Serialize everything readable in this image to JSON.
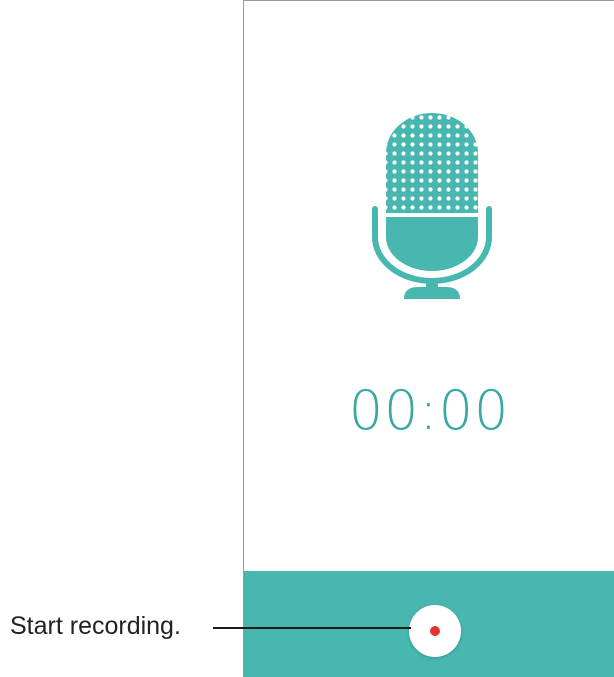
{
  "recorder": {
    "timer": "00:00",
    "accent_color": "#47b7af",
    "record_dot_color": "#e5342b",
    "mic_icon": "microphone-icon",
    "record_icon": "record-dot-icon"
  },
  "callout": {
    "label": "Start recording."
  }
}
